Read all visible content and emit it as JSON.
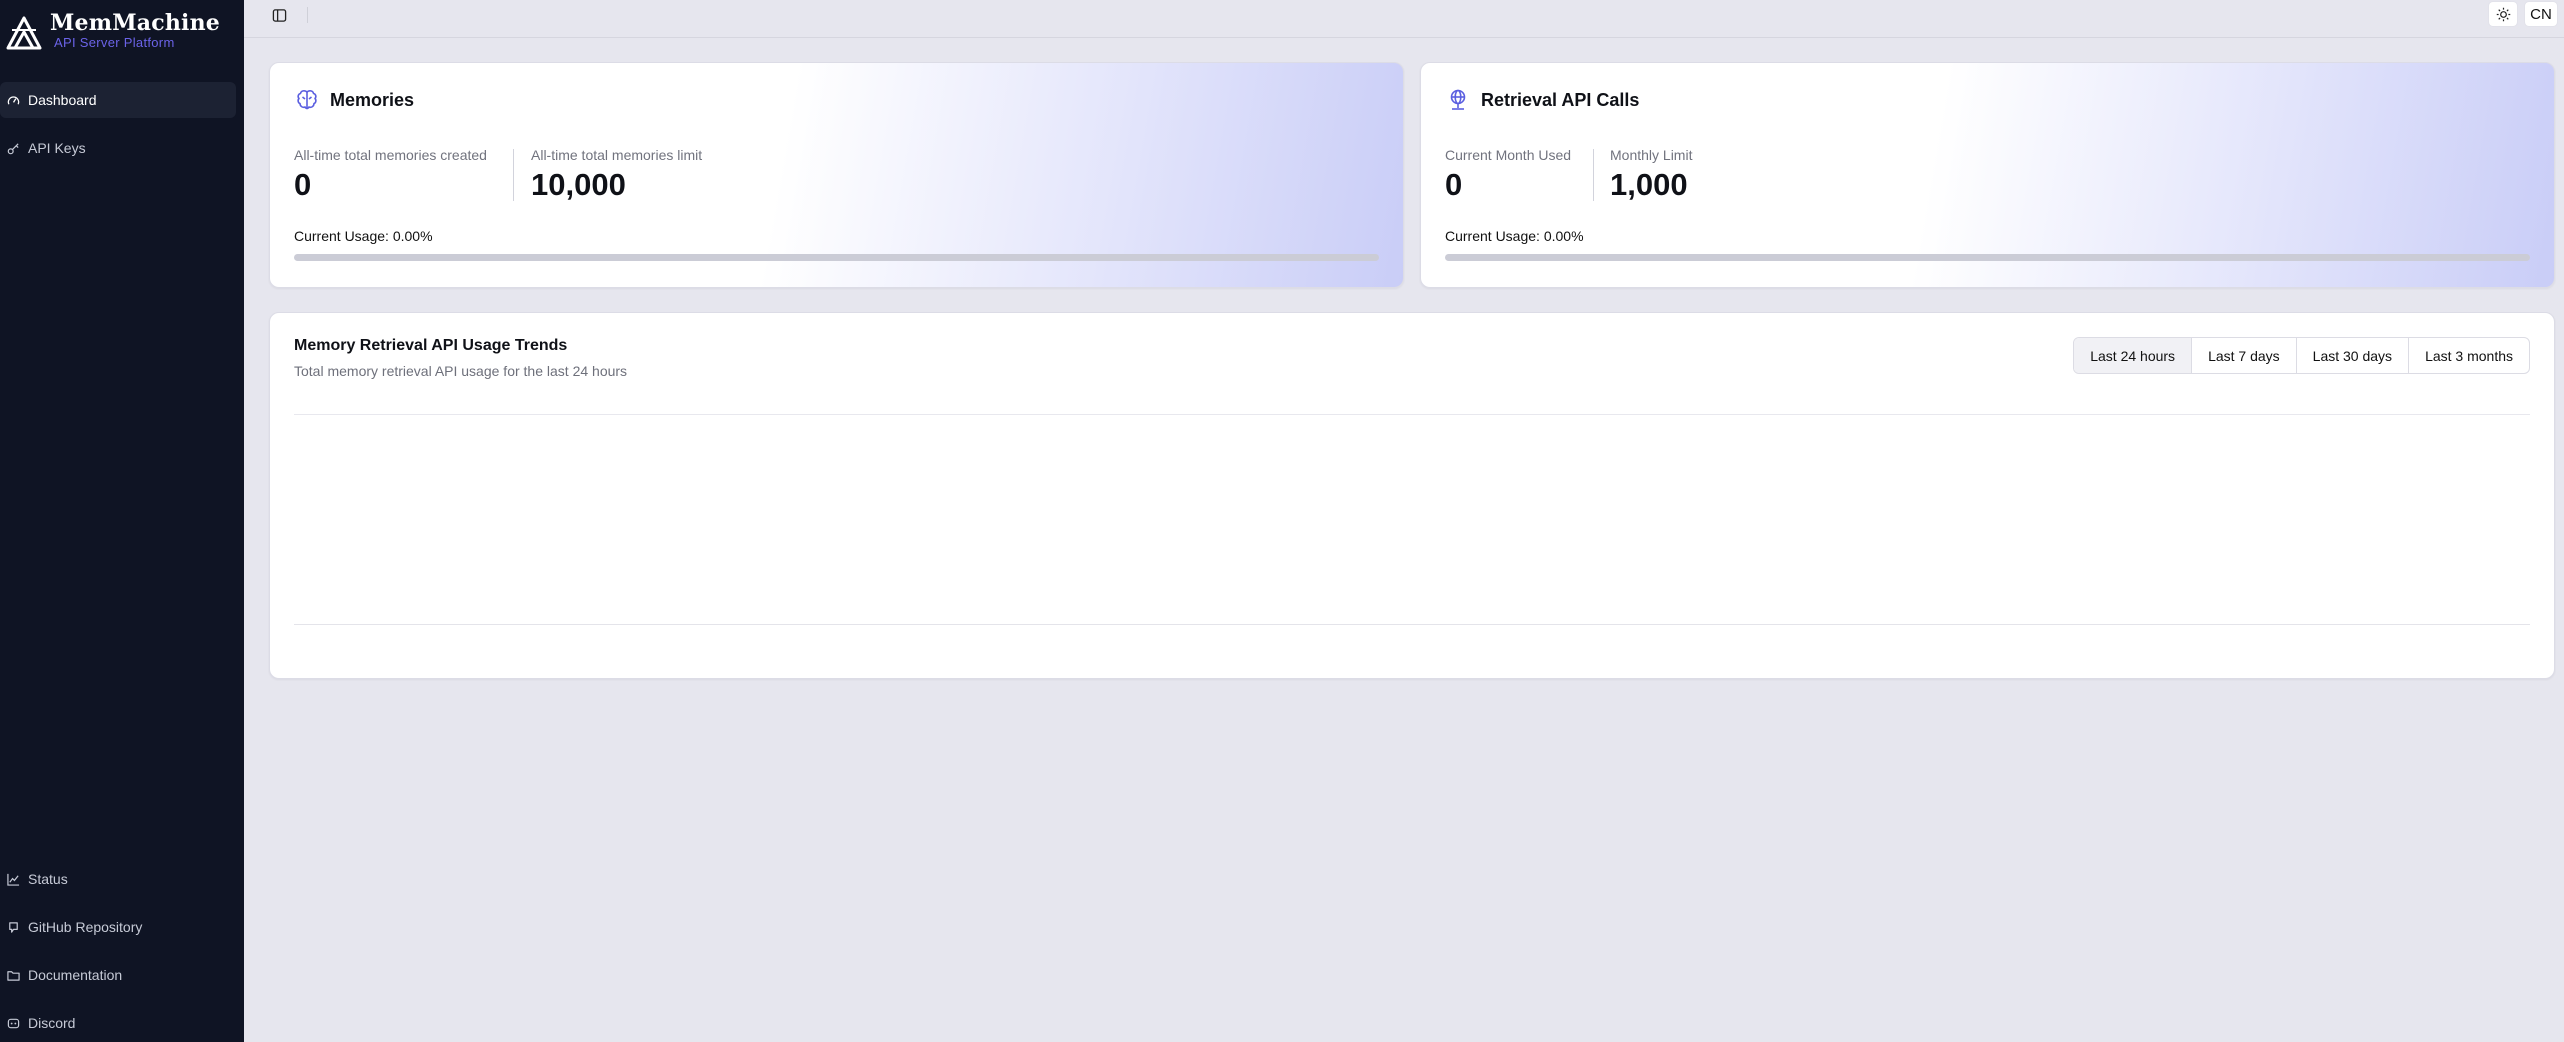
{
  "brand": {
    "name": "MemMachine",
    "tagline": "API Server Platform"
  },
  "sidebar": {
    "top_items": [
      {
        "label": "Dashboard",
        "icon": "gauge-icon",
        "active": true
      },
      {
        "label": "API Keys",
        "icon": "key-icon",
        "active": false
      }
    ],
    "bottom_items": [
      {
        "label": "Status",
        "icon": "chart-line-icon"
      },
      {
        "label": "GitHub Repository",
        "icon": "github-icon"
      },
      {
        "label": "Documentation",
        "icon": "folder-icon"
      },
      {
        "label": "Discord",
        "icon": "discord-icon"
      }
    ]
  },
  "topbar": {
    "language": "CN",
    "theme_icon": "sun-icon",
    "toggle_icon": "sidebar-toggle-icon"
  },
  "memories_card": {
    "title": "Memories",
    "icon": "brain-icon",
    "metrics": [
      {
        "label": "All-time total memories created",
        "value": "0"
      },
      {
        "label": "All-time total memories limit",
        "value": "10,000"
      }
    ],
    "usage_text": "Current Usage: 0.00%",
    "usage_fraction": 0.0
  },
  "retrieval_card": {
    "title": "Retrieval API Calls",
    "icon": "globe-icon",
    "metrics": [
      {
        "label": "Current Month Used",
        "value": "0"
      },
      {
        "label": "Monthly Limit",
        "value": "1,000"
      }
    ],
    "usage_text": "Current Usage: 0.00%",
    "usage_fraction": 0.0
  },
  "trends": {
    "title": "Memory Retrieval API Usage Trends",
    "subtitle": "Total memory retrieval API usage for the last 24 hours",
    "ranges": [
      "Last 24 hours",
      "Last 7 days",
      "Last 30 days",
      "Last 3 months"
    ],
    "selected_range": "Last 24 hours"
  },
  "colors": {
    "sidebar_bg": "#0f1424",
    "accent": "#5b5fe0",
    "page_bg": "#e6e6ee"
  }
}
